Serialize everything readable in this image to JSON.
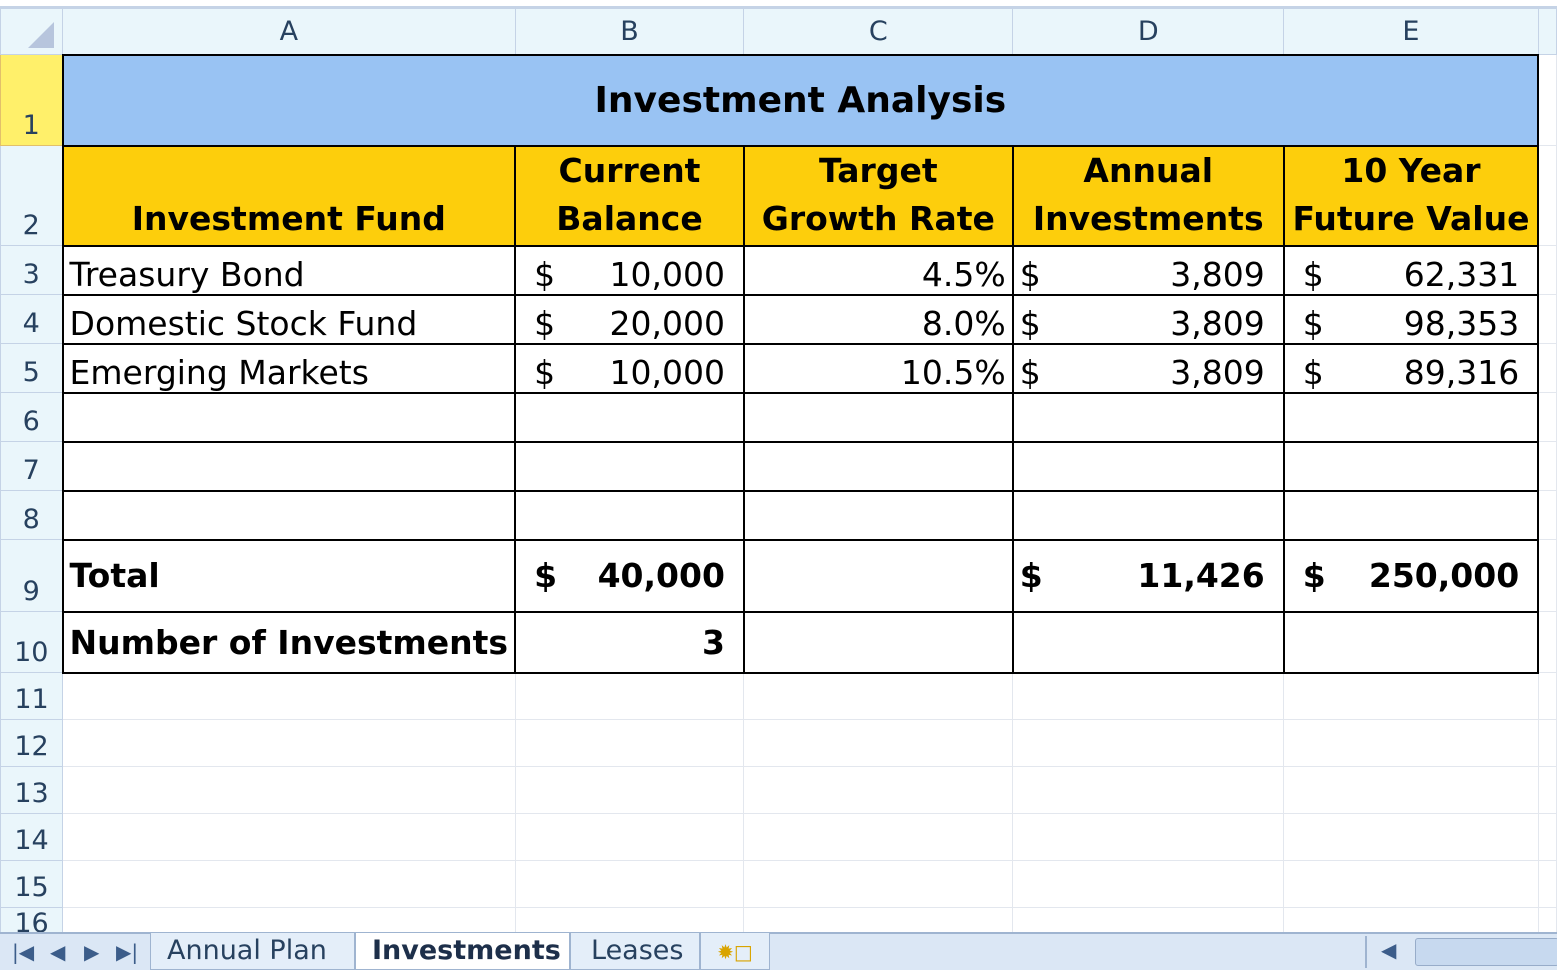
{
  "columns": [
    "A",
    "B",
    "C",
    "D",
    "E"
  ],
  "title": "Investment Analysis",
  "headers": [
    "Investment Fund",
    "Current Balance",
    "Target Growth Rate",
    "Annual Investments",
    "10 Year Future Value"
  ],
  "rows": [
    {
      "num": "3",
      "cells": [
        "Treasury Bond",
        {
          "d": "$",
          "v": "10,000"
        },
        "4.5%",
        {
          "d": "$",
          "v": "3,809"
        },
        {
          "d": "$",
          "v": "62,331"
        }
      ]
    },
    {
      "num": "4",
      "cells": [
        "Domestic Stock Fund",
        {
          "d": "$",
          "v": "20,000"
        },
        "8.0%",
        {
          "d": "$",
          "v": "3,809"
        },
        {
          "d": "$",
          "v": "98,353"
        }
      ]
    },
    {
      "num": "5",
      "cells": [
        "Emerging Markets",
        {
          "d": "$",
          "v": "10,000"
        },
        "10.5%",
        {
          "d": "$",
          "v": "3,809"
        },
        {
          "d": "$",
          "v": "89,316"
        }
      ]
    },
    {
      "num": "6",
      "cells": [
        "",
        "",
        "",
        "",
        ""
      ]
    },
    {
      "num": "7",
      "cells": [
        "",
        "",
        "",
        "",
        ""
      ]
    },
    {
      "num": "8",
      "cells": [
        "",
        "",
        "",
        "",
        ""
      ]
    },
    {
      "num": "9",
      "bold": true,
      "cells": [
        "Total",
        {
          "d": "$",
          "v": "40,000"
        },
        "",
        {
          "d": "$",
          "v": "11,426"
        },
        {
          "d": "$",
          "v": "250,000"
        }
      ]
    },
    {
      "num": "10",
      "bold": true,
      "cells": [
        "Number of Investments",
        "3",
        "",
        "",
        ""
      ]
    }
  ],
  "empty_rows": [
    "11",
    "12",
    "13",
    "14",
    "15",
    "16"
  ],
  "sheet_tabs": [
    {
      "label": "Annual Plan",
      "active": false
    },
    {
      "label": "Investments",
      "active": true
    },
    {
      "label": "Leases",
      "active": false
    }
  ],
  "nav_icons": [
    "first-sheet-icon",
    "prev-sheet-icon",
    "next-sheet-icon",
    "last-sheet-icon"
  ],
  "colors": {
    "title_fill": "#99c3f3",
    "header_fill": "#fdce0c",
    "selected_row_header": "#fff06a"
  }
}
